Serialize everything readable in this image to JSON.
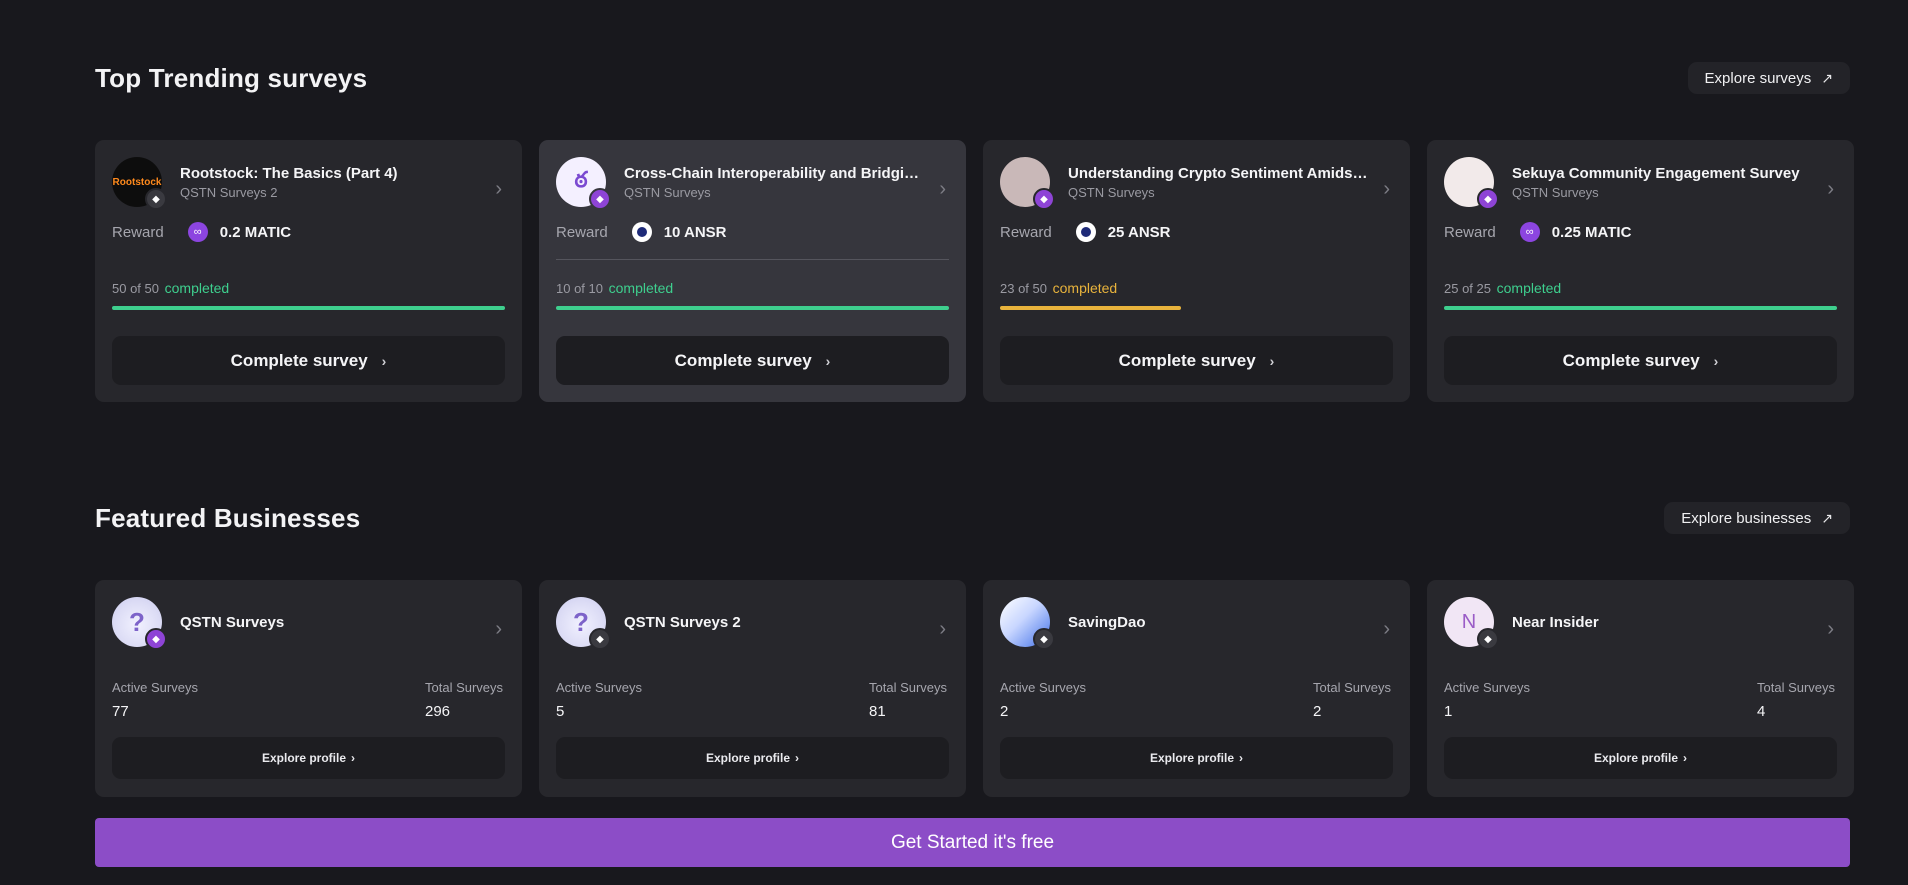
{
  "trending": {
    "title": "Top Trending surveys",
    "explore_label": "Explore surveys",
    "reward_label": "Reward",
    "completed_word": "completed",
    "cta_label": "Complete survey",
    "cards": [
      {
        "title": "Rootstock: The Basics (Part 4)",
        "org": "QSTN Surveys 2",
        "reward": "0.2 MATIC",
        "token": "matic",
        "progress_text": "50 of 50",
        "progress": 1.0,
        "status_color": "#3ecf8e",
        "avatar_text": "Rootstock",
        "avatar_bg": "#0d0d0d",
        "avatar_color": "#ff8a1d",
        "badge": "dark",
        "highlight": false
      },
      {
        "title": "Cross-Chain Interoperability and Bridging...",
        "org": "QSTN Surveys",
        "reward": "10 ANSR",
        "token": "ansr",
        "progress_text": "10 of 10",
        "progress": 1.0,
        "status_color": "#3ecf8e",
        "avatar_text": "ఠ",
        "avatar_bg": "#f4f0ff",
        "avatar_color": "#7b4ad1",
        "badge": "purple",
        "highlight": true
      },
      {
        "title": "Understanding Crypto Sentiment Amidst I...",
        "org": "QSTN Surveys",
        "reward": "25 ANSR",
        "token": "ansr",
        "progress_text": "23 of 50",
        "progress": 0.46,
        "status_color": "#e8b33c",
        "avatar_text": "",
        "avatar_bg": "#c9b8b8",
        "avatar_color": "#b33",
        "badge": "purple",
        "highlight": false
      },
      {
        "title": "Sekuya Community Engagement Survey",
        "org": "QSTN Surveys",
        "reward": "0.25 MATIC",
        "token": "matic",
        "progress_text": "25 of 25",
        "progress": 1.0,
        "status_color": "#3ecf8e",
        "avatar_text": "",
        "avatar_bg": "#f2eaea",
        "avatar_color": "#c33",
        "badge": "purple",
        "highlight": false
      }
    ]
  },
  "businesses": {
    "title": "Featured Businesses",
    "explore_label": "Explore businesses",
    "active_label": "Active Surveys",
    "total_label": "Total Surveys",
    "profile_label": "Explore profile",
    "cards": [
      {
        "name": "QSTN Surveys",
        "active": "77",
        "total": "296",
        "avatar": "qstn",
        "avatar_text": "?",
        "badge": "purple"
      },
      {
        "name": "QSTN Surveys 2",
        "active": "5",
        "total": "81",
        "avatar": "qstn",
        "avatar_text": "?",
        "badge": "dark"
      },
      {
        "name": "SavingDao",
        "active": "2",
        "total": "2",
        "avatar": "savingdao",
        "avatar_text": "",
        "badge": "dark"
      },
      {
        "name": "Near Insider",
        "active": "1",
        "total": "4",
        "avatar": "letter",
        "avatar_text": "N",
        "badge": "dark"
      }
    ]
  },
  "cta": {
    "label": "Get Started it's free"
  },
  "colors": {
    "accent": "#8c4dc7",
    "success": "#3ecf8e",
    "warning": "#e8b33c"
  }
}
